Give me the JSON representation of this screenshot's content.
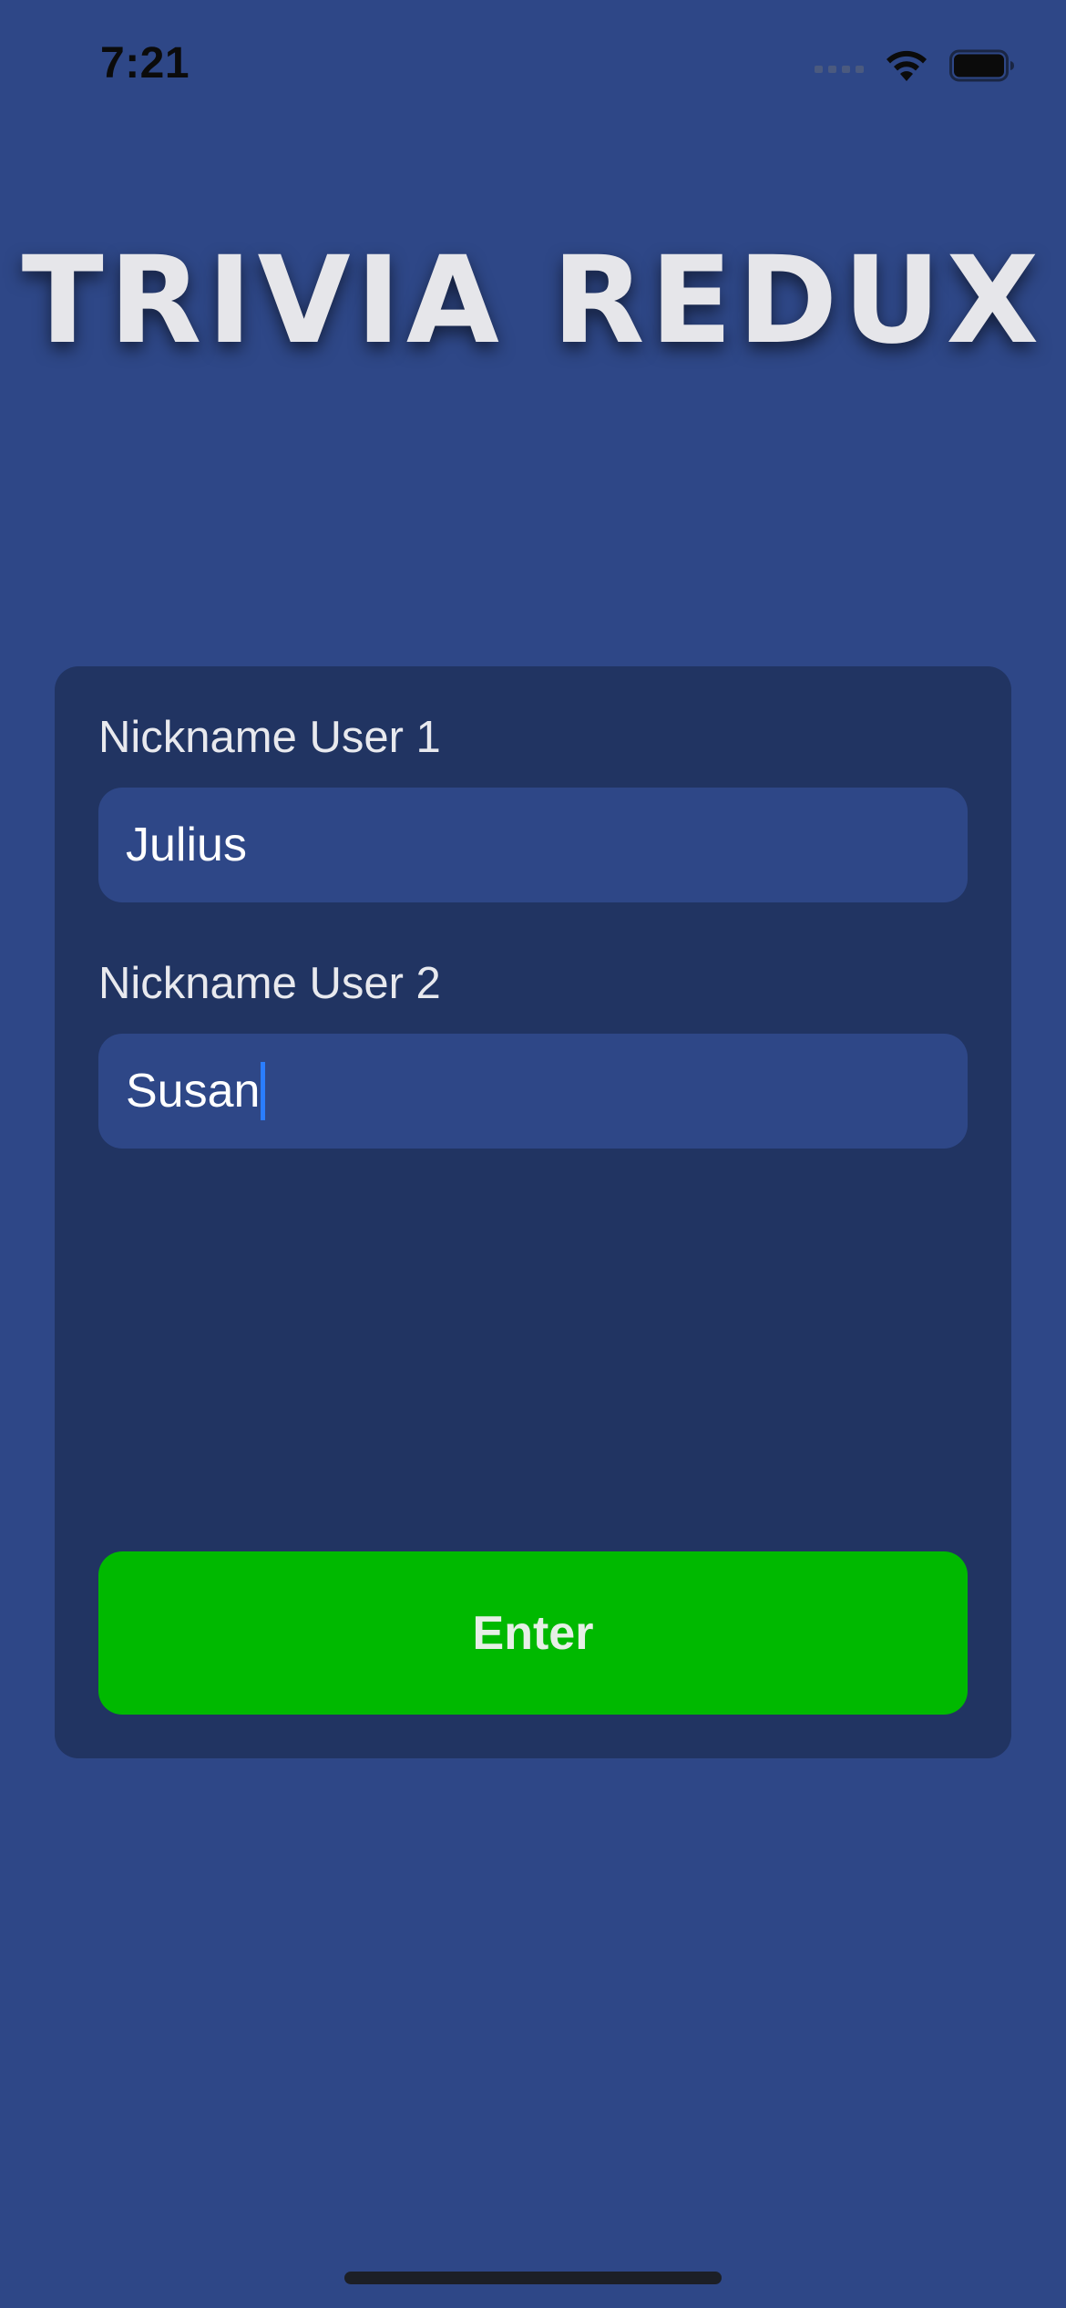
{
  "status_bar": {
    "time": "7:21"
  },
  "app": {
    "title": "TRIVIA REDUX"
  },
  "form": {
    "user1_label": "Nickname User 1",
    "user1_value": "Julius",
    "user2_label": "Nickname User 2",
    "user2_value": "Susan",
    "enter_label": "Enter"
  },
  "icons": {
    "signal": "cellular-signal-icon",
    "wifi": "wifi-icon",
    "battery": "battery-icon"
  },
  "colors": {
    "background": "#2e4787",
    "card": "#213462",
    "input": "#2e4787",
    "button": "#00b900",
    "cursor": "#2a7dff"
  }
}
